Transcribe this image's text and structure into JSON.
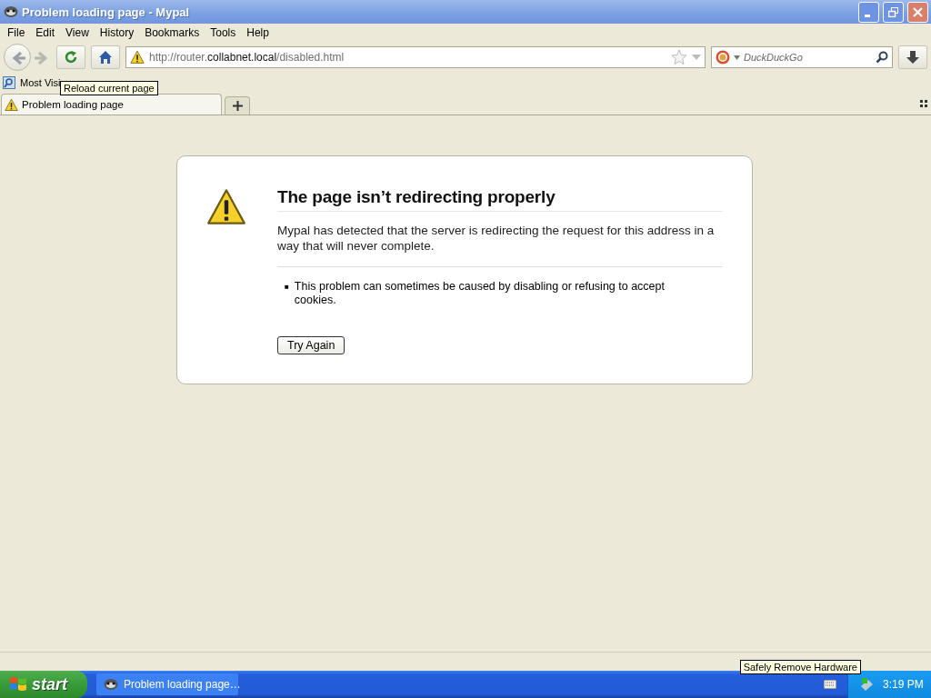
{
  "window": {
    "title": "Problem loading page - Mypal"
  },
  "menu": [
    "File",
    "Edit",
    "View",
    "History",
    "Bookmarks",
    "Tools",
    "Help"
  ],
  "navigation": {
    "back_disabled": false,
    "forward_disabled": true,
    "url_start": "http://router.",
    "url_host": "collabnet.local",
    "url_end": "/disabled.html",
    "search_placeholder": "DuckDuckGo",
    "tooltip": "Reload current page"
  },
  "bookmarks": [
    {
      "label": "Most Visi"
    }
  ],
  "tabs": [
    {
      "label": "Problem loading page",
      "selected": true
    }
  ],
  "error": {
    "title": "The page isn’t redirecting properly",
    "description": "Mypal has detected that the server is redirecting the request for this address in a way that will never complete.",
    "hints": [
      {
        "marker": "■",
        "text": "This problem can sometimes be caused by disabling or refusing to accept cookies."
      }
    ],
    "button": "Try Again"
  },
  "taskbar": {
    "start": "start",
    "tasks": [
      {
        "label": "Problem loading page…",
        "selected": false
      }
    ],
    "clock": "3:19 PM",
    "tooltip": "Safely Remove Hardware"
  }
}
